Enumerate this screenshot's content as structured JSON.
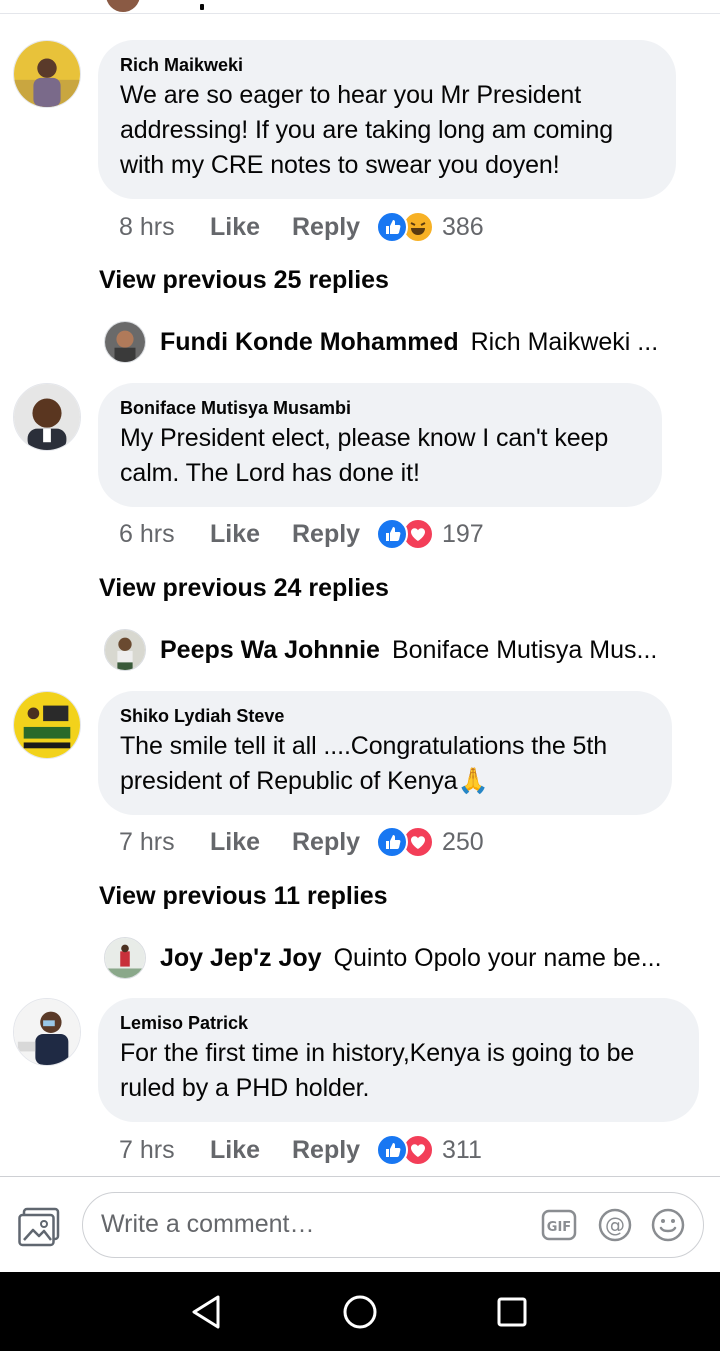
{
  "comments": [
    {
      "author": "Rich Maikweki",
      "text": "We are so eager to hear you Mr President addressing! If you are taking long am coming with my CRE notes to swear you doyen!",
      "time": "8 hrs",
      "like_label": "Like",
      "reply_label": "Reply",
      "reaction_count": "386",
      "second_reaction": "haha-icon",
      "view_previous": "View previous 25 replies",
      "latest_reply": {
        "author": "Fundi Konde Mohammed",
        "text": "Rich Maikweki ..."
      }
    },
    {
      "author": "Boniface Mutisya Musambi",
      "text": "My President elect, please know I can't keep calm. The Lord has done it!",
      "time": "6 hrs",
      "like_label": "Like",
      "reply_label": "Reply",
      "reaction_count": "197",
      "second_reaction": "love-icon",
      "view_previous": "View previous 24 replies",
      "latest_reply": {
        "author": "Peeps Wa Johnnie",
        "text": "Boniface Mutisya Mus..."
      }
    },
    {
      "author": "Shiko Lydiah Steve",
      "text": "The smile tell it all ....Congratulations the 5th president of Republic of Kenya🙏",
      "time": "7 hrs",
      "like_label": "Like",
      "reply_label": "Reply",
      "reaction_count": "250",
      "second_reaction": "love-icon",
      "view_previous": "View previous 11 replies",
      "latest_reply": {
        "author": "Joy Jep'z Joy",
        "text": "Quinto Opolo your name be..."
      }
    },
    {
      "author": "Lemiso Patrick",
      "text": "For the first time in history,Kenya is going to be ruled by a PHD holder.",
      "time": "7 hrs",
      "like_label": "Like",
      "reply_label": "Reply",
      "reaction_count": "311",
      "second_reaction": "love-icon"
    }
  ],
  "composer": {
    "placeholder": "Write a comment…",
    "icons": [
      "photo-icon",
      "gif-icon",
      "mention-icon",
      "emoji-icon"
    ]
  },
  "navbar": {
    "icons": [
      "back-icon",
      "home-icon",
      "recents-icon"
    ]
  },
  "colors": {
    "bubble": "#f0f2f5",
    "meta_text": "#65676b",
    "like_blue": "#1877f2",
    "love_red": "#f33e58",
    "haha_yellow": "#f7b125"
  }
}
